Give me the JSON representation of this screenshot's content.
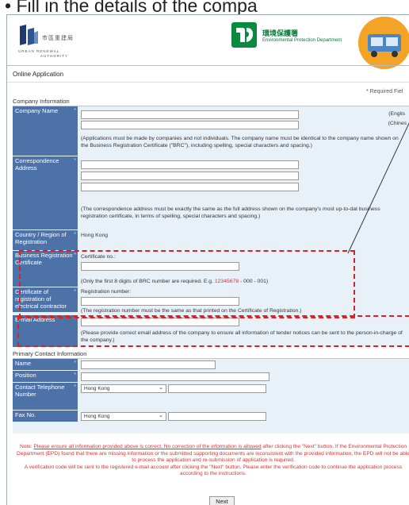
{
  "caption": "• Fill in the details of the compa",
  "header": {
    "ura_chinese": "市區重建局",
    "ura_english_line1": "URBAN RENEWAL",
    "ura_english_line2": "AUTHORITY",
    "epd_chinese": "環境保護署",
    "epd_english": "Environmental Protection Department"
  },
  "page_title": "Online Application",
  "required_note": "* Required Fiel",
  "company_section": {
    "title": "Company Information",
    "company_name_label": "Company Name",
    "english_tag": "(Englis",
    "chinese_tag": "(Chines",
    "company_name_note": "(Applications must be made by companies and not individuals. The company name must be identical to the company name shown on the Business Registration Certificate (\"BRC\"), including spelling, special characters and spacing.)",
    "correspondence_label": "Correspondence Address",
    "correspondence_note": "(The correspondence address must be exactly the same as the full address shown on the company's most up-to-dat business registration certificate, in terms of spelling, special characters and spacing.)",
    "country_label": "Country / Region of Registration",
    "country_value": "Hong Kong",
    "brc_label": "Business Registration Certificate",
    "brc_field_label": "Certificate no.:",
    "brc_note_prefix": "(Only the first 8 digits of BRC number are required. E.g. ",
    "brc_note_example": "12345678",
    "brc_note_suffix": " - 000 - 001)",
    "cert_label": "Certificate of registration of electrical contractor",
    "cert_field_label": "Registration number:",
    "cert_note": "(The registration number must be the same as that printed on the Certificate of Registration.)",
    "email_label": "E-mail Address",
    "email_note": "(Please provide correct email address of the company to ensure all information of tender notices can be sent to the person-in-charge of the company.)"
  },
  "contact_section": {
    "title": "Primary Contact Information",
    "name_label": "Name",
    "position_label": "Position",
    "phone_label": "Contact Telephone Number",
    "phone_region": "Hong Kong",
    "fax_label": "Fax No.",
    "fax_region": "Hong Kong"
  },
  "note": {
    "prefix": "Note: ",
    "underlined": "Please ensure all information provided above is correct. No correction of the information is allowed",
    "body": " after clicking the \"Next\" button. If the Environmental Protection Department (EPD) found that there are missing information or the submitted supporting documents are inconsistent with the provided information, the EPD will not be able to process the application and re-submission of application is required.",
    "verification": "A verification code will be sent to the registered e-mail account after clicking the \"Next\" button. Please enter the verification code to continue the application process according to the instructions."
  },
  "next_label": "Next",
  "colors": {
    "label_bg": "#4d72a8",
    "row_bg": "#e8f0f8",
    "highlight": "#e02020",
    "note_red": "#d8342e"
  }
}
